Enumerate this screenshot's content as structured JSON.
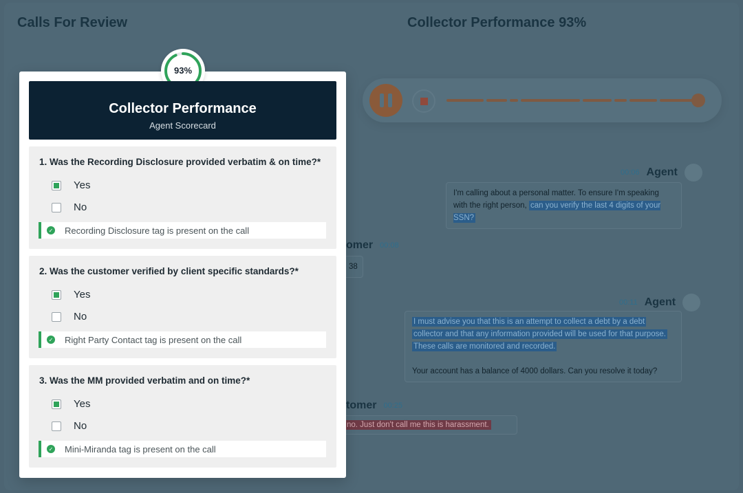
{
  "background": {
    "left_title": "Calls For Review",
    "right_title": "Collector Performance 93%",
    "transcript": [
      {
        "time": "00:06",
        "speaker": "Agent",
        "text_plain": "I'm calling about a personal matter. To ensure I'm speaking with the right person,",
        "text_highlight": "can you verify the last 4 digits of your SSN?"
      },
      {
        "time": "00:08",
        "speaker": "omer",
        "text_plain": "38"
      },
      {
        "time": "00:11",
        "speaker": "Agent",
        "line1": "I must advise you that this is an attempt to collect a debt by a debt",
        "line2": "collector and that any information provided will be used for that purpose.",
        "line3": "These calls are monitored and recorded.",
        "line4": "Your account has a balance of 4000 dollars. Can you resolve it today?"
      },
      {
        "time": "00:25",
        "speaker": "tomer",
        "text_highlight": "no.  Just don't call me this is harassment."
      }
    ]
  },
  "card": {
    "score": "93%",
    "score_fraction": 0.93,
    "title": "Collector Performance",
    "subtitle": "Agent Scorecard",
    "questions": [
      {
        "text": "1. Was the Recording Disclosure provided verbatim & on time?*",
        "yes": "Yes",
        "no": "No",
        "selected": "yes",
        "tag": "Recording Disclosure tag is present on the call"
      },
      {
        "text": "2. Was the customer verified by client specific standards?*",
        "yes": "Yes",
        "no": "No",
        "selected": "yes",
        "tag": "Right Party Contact tag is present on the call"
      },
      {
        "text": "3. Was the MM provided verbatim and on time?*",
        "yes": "Yes",
        "no": "No",
        "selected": "yes",
        "tag": "Mini-Miranda tag is present on the call"
      }
    ]
  },
  "colors": {
    "accent_green": "#2fa35a",
    "header_navy": "#0c2233",
    "player_brown": "#8a5a3a"
  },
  "icons": {
    "play_state": "pause-icon",
    "stop": "stop-icon",
    "check": "check-circle-icon"
  }
}
